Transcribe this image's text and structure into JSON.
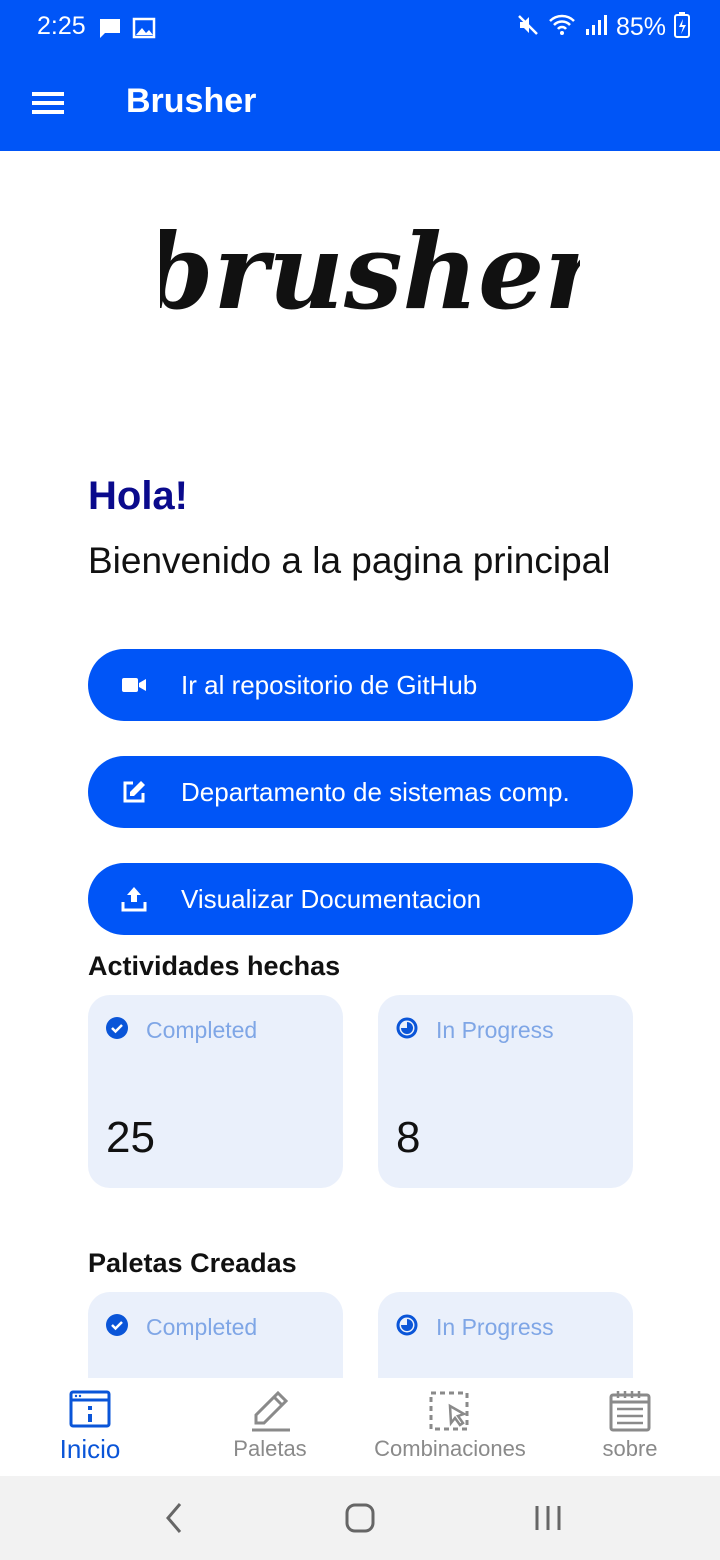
{
  "status_bar": {
    "time": "2:25",
    "battery": "85%"
  },
  "app_bar": {
    "title": "Brusher"
  },
  "logo": {
    "text": "brusher"
  },
  "hero": {
    "greeting": "Hola!",
    "subtitle": "Bienvenido a la pagina principal"
  },
  "actions": [
    {
      "label": "Ir al repositorio de GitHub",
      "icon": "video-camera-icon"
    },
    {
      "label": "Departamento de sistemas comp.",
      "icon": "edit-icon"
    },
    {
      "label": "Visualizar Documentacion",
      "icon": "upload-icon"
    }
  ],
  "sections": [
    {
      "title": "Actividades hechas",
      "cards": [
        {
          "label": "Completed",
          "value": "25",
          "icon": "check-circle-icon"
        },
        {
          "label": "In Progress",
          "value": "8",
          "icon": "progress-circle-icon"
        }
      ]
    },
    {
      "title": "Paletas Creadas",
      "cards": [
        {
          "label": "Completed",
          "icon": "check-circle-icon"
        },
        {
          "label": "In Progress",
          "icon": "progress-circle-icon"
        }
      ]
    }
  ],
  "bottom_nav": [
    {
      "label": "Inicio",
      "icon": "browser-window-icon",
      "active": true
    },
    {
      "label": "Paletas",
      "icon": "pencil-icon",
      "active": false
    },
    {
      "label": "Combinaciones",
      "icon": "selection-cursor-icon",
      "active": false
    },
    {
      "label": "sobre",
      "icon": "notepad-icon",
      "active": false
    }
  ],
  "colors": {
    "primary": "#0055f7",
    "greeting": "#0a0a8c",
    "card_bg": "#eaf0fb",
    "card_label": "#7fa6e6",
    "nav_active": "#0a55d8",
    "nav_inactive": "#8a8a8a"
  }
}
